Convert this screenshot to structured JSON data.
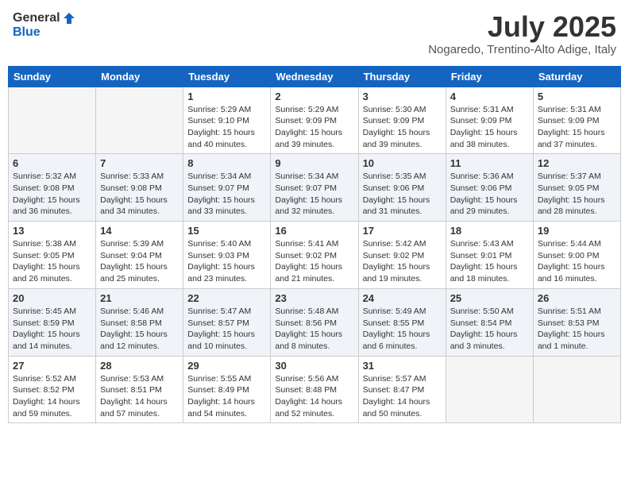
{
  "header": {
    "logo_general": "General",
    "logo_blue": "Blue",
    "month": "July 2025",
    "location": "Nogaredo, Trentino-Alto Adige, Italy"
  },
  "weekdays": [
    "Sunday",
    "Monday",
    "Tuesday",
    "Wednesday",
    "Thursday",
    "Friday",
    "Saturday"
  ],
  "weeks": [
    [
      {
        "day": "",
        "info": ""
      },
      {
        "day": "",
        "info": ""
      },
      {
        "day": "1",
        "info": "Sunrise: 5:29 AM\nSunset: 9:10 PM\nDaylight: 15 hours and 40 minutes."
      },
      {
        "day": "2",
        "info": "Sunrise: 5:29 AM\nSunset: 9:09 PM\nDaylight: 15 hours and 39 minutes."
      },
      {
        "day": "3",
        "info": "Sunrise: 5:30 AM\nSunset: 9:09 PM\nDaylight: 15 hours and 39 minutes."
      },
      {
        "day": "4",
        "info": "Sunrise: 5:31 AM\nSunset: 9:09 PM\nDaylight: 15 hours and 38 minutes."
      },
      {
        "day": "5",
        "info": "Sunrise: 5:31 AM\nSunset: 9:09 PM\nDaylight: 15 hours and 37 minutes."
      }
    ],
    [
      {
        "day": "6",
        "info": "Sunrise: 5:32 AM\nSunset: 9:08 PM\nDaylight: 15 hours and 36 minutes."
      },
      {
        "day": "7",
        "info": "Sunrise: 5:33 AM\nSunset: 9:08 PM\nDaylight: 15 hours and 34 minutes."
      },
      {
        "day": "8",
        "info": "Sunrise: 5:34 AM\nSunset: 9:07 PM\nDaylight: 15 hours and 33 minutes."
      },
      {
        "day": "9",
        "info": "Sunrise: 5:34 AM\nSunset: 9:07 PM\nDaylight: 15 hours and 32 minutes."
      },
      {
        "day": "10",
        "info": "Sunrise: 5:35 AM\nSunset: 9:06 PM\nDaylight: 15 hours and 31 minutes."
      },
      {
        "day": "11",
        "info": "Sunrise: 5:36 AM\nSunset: 9:06 PM\nDaylight: 15 hours and 29 minutes."
      },
      {
        "day": "12",
        "info": "Sunrise: 5:37 AM\nSunset: 9:05 PM\nDaylight: 15 hours and 28 minutes."
      }
    ],
    [
      {
        "day": "13",
        "info": "Sunrise: 5:38 AM\nSunset: 9:05 PM\nDaylight: 15 hours and 26 minutes."
      },
      {
        "day": "14",
        "info": "Sunrise: 5:39 AM\nSunset: 9:04 PM\nDaylight: 15 hours and 25 minutes."
      },
      {
        "day": "15",
        "info": "Sunrise: 5:40 AM\nSunset: 9:03 PM\nDaylight: 15 hours and 23 minutes."
      },
      {
        "day": "16",
        "info": "Sunrise: 5:41 AM\nSunset: 9:02 PM\nDaylight: 15 hours and 21 minutes."
      },
      {
        "day": "17",
        "info": "Sunrise: 5:42 AM\nSunset: 9:02 PM\nDaylight: 15 hours and 19 minutes."
      },
      {
        "day": "18",
        "info": "Sunrise: 5:43 AM\nSunset: 9:01 PM\nDaylight: 15 hours and 18 minutes."
      },
      {
        "day": "19",
        "info": "Sunrise: 5:44 AM\nSunset: 9:00 PM\nDaylight: 15 hours and 16 minutes."
      }
    ],
    [
      {
        "day": "20",
        "info": "Sunrise: 5:45 AM\nSunset: 8:59 PM\nDaylight: 15 hours and 14 minutes."
      },
      {
        "day": "21",
        "info": "Sunrise: 5:46 AM\nSunset: 8:58 PM\nDaylight: 15 hours and 12 minutes."
      },
      {
        "day": "22",
        "info": "Sunrise: 5:47 AM\nSunset: 8:57 PM\nDaylight: 15 hours and 10 minutes."
      },
      {
        "day": "23",
        "info": "Sunrise: 5:48 AM\nSunset: 8:56 PM\nDaylight: 15 hours and 8 minutes."
      },
      {
        "day": "24",
        "info": "Sunrise: 5:49 AM\nSunset: 8:55 PM\nDaylight: 15 hours and 6 minutes."
      },
      {
        "day": "25",
        "info": "Sunrise: 5:50 AM\nSunset: 8:54 PM\nDaylight: 15 hours and 3 minutes."
      },
      {
        "day": "26",
        "info": "Sunrise: 5:51 AM\nSunset: 8:53 PM\nDaylight: 15 hours and 1 minute."
      }
    ],
    [
      {
        "day": "27",
        "info": "Sunrise: 5:52 AM\nSunset: 8:52 PM\nDaylight: 14 hours and 59 minutes."
      },
      {
        "day": "28",
        "info": "Sunrise: 5:53 AM\nSunset: 8:51 PM\nDaylight: 14 hours and 57 minutes."
      },
      {
        "day": "29",
        "info": "Sunrise: 5:55 AM\nSunset: 8:49 PM\nDaylight: 14 hours and 54 minutes."
      },
      {
        "day": "30",
        "info": "Sunrise: 5:56 AM\nSunset: 8:48 PM\nDaylight: 14 hours and 52 minutes."
      },
      {
        "day": "31",
        "info": "Sunrise: 5:57 AM\nSunset: 8:47 PM\nDaylight: 14 hours and 50 minutes."
      },
      {
        "day": "",
        "info": ""
      },
      {
        "day": "",
        "info": ""
      }
    ]
  ]
}
